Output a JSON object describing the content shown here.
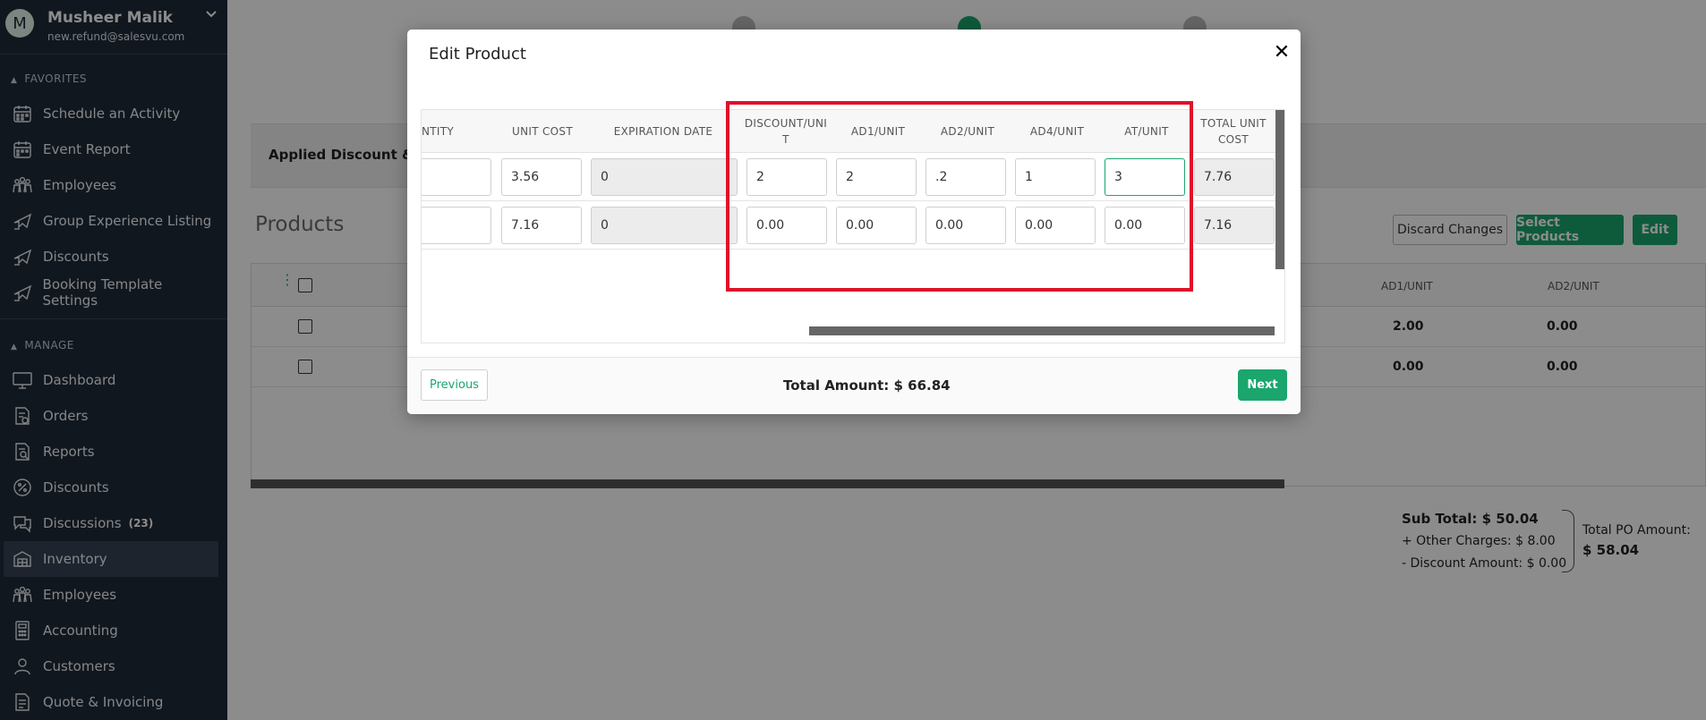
{
  "user": {
    "initial": "M",
    "name": "Musheer Malik",
    "email": "new.refund@salesvu.com"
  },
  "sidebar": {
    "favorites_header": "FAVORITES",
    "favorites": [
      {
        "label": "Schedule an Activity",
        "icon": "calendar-grid-icon"
      },
      {
        "label": "Event Report",
        "icon": "calendar-grid-icon"
      },
      {
        "label": "Employees",
        "icon": "people-group-icon"
      },
      {
        "label": "Group Experience Listing",
        "icon": "plane-icon"
      },
      {
        "label": "Discounts",
        "icon": "plane-icon"
      },
      {
        "label": "Booking Template Settings",
        "icon": "plane-icon"
      }
    ],
    "manage_header": "MANAGE",
    "manage": [
      {
        "label": "Dashboard",
        "icon": "monitor-icon"
      },
      {
        "label": "Orders",
        "icon": "orders-icon"
      },
      {
        "label": "Reports",
        "icon": "reports-icon"
      },
      {
        "label": "Discounts",
        "icon": "percent-icon"
      },
      {
        "label": "Discussions",
        "badge": "(23)",
        "icon": "chat-icon"
      },
      {
        "label": "Inventory",
        "icon": "inventory-icon",
        "active": true
      },
      {
        "label": "Employees",
        "icon": "people-group-icon"
      },
      {
        "label": "Accounting",
        "icon": "calculator-icon"
      },
      {
        "label": "Customers",
        "icon": "person-icon"
      },
      {
        "label": "Quote & Invoicing",
        "icon": "document-icon"
      }
    ]
  },
  "background": {
    "applied_label": "Applied Discount & Cha",
    "products_title": "Products",
    "discard_label": "Discard Changes",
    "select_products_label": "Select Products",
    "edit_label": "Edit",
    "columns": [
      "AD1/UNIT",
      "AD2/UNIT"
    ],
    "rows": [
      [
        "2.00",
        "0.00"
      ],
      [
        "0.00",
        "0.00"
      ]
    ],
    "subtotal": "Sub Total: $ 50.04",
    "other_charges": "+ Other Charges: $ 8.00",
    "discount_amount": "- Discount Amount: $ 0.00",
    "total_po_label": "Total PO Amount:",
    "total_po_value": "$ 58.04"
  },
  "modal": {
    "title": "Edit Product",
    "close_icon": "close-icon",
    "headers": {
      "quantity": "NTITY",
      "unit_cost": "UNIT COST",
      "expiration_date": "EXPIRATION DATE",
      "discount_unit_1": "DISCOUNT/UNI",
      "discount_unit_2": "T",
      "ad1": "AD1/UNIT",
      "ad2": "AD2/UNIT",
      "ad4": "AD4/UNIT",
      "at": "AT/UNIT",
      "total_unit_cost_1": "TOTAL UNIT",
      "total_unit_cost_2": "COST"
    },
    "rows": [
      {
        "quantity": "",
        "unit_cost": "3.56",
        "expiration": "0",
        "discount": "2",
        "ad1": "2",
        "ad2": ".2",
        "ad4": "1",
        "at": "3",
        "total": "7.76"
      },
      {
        "quantity": "",
        "unit_cost": "7.16",
        "expiration": "0",
        "discount": "0.00",
        "ad1": "0.00",
        "ad2": "0.00",
        "ad4": "0.00",
        "at": "0.00",
        "total": "7.16"
      }
    ],
    "previous_label": "Previous",
    "total_amount": "Total Amount: $ 66.84",
    "next_label": "Next"
  }
}
